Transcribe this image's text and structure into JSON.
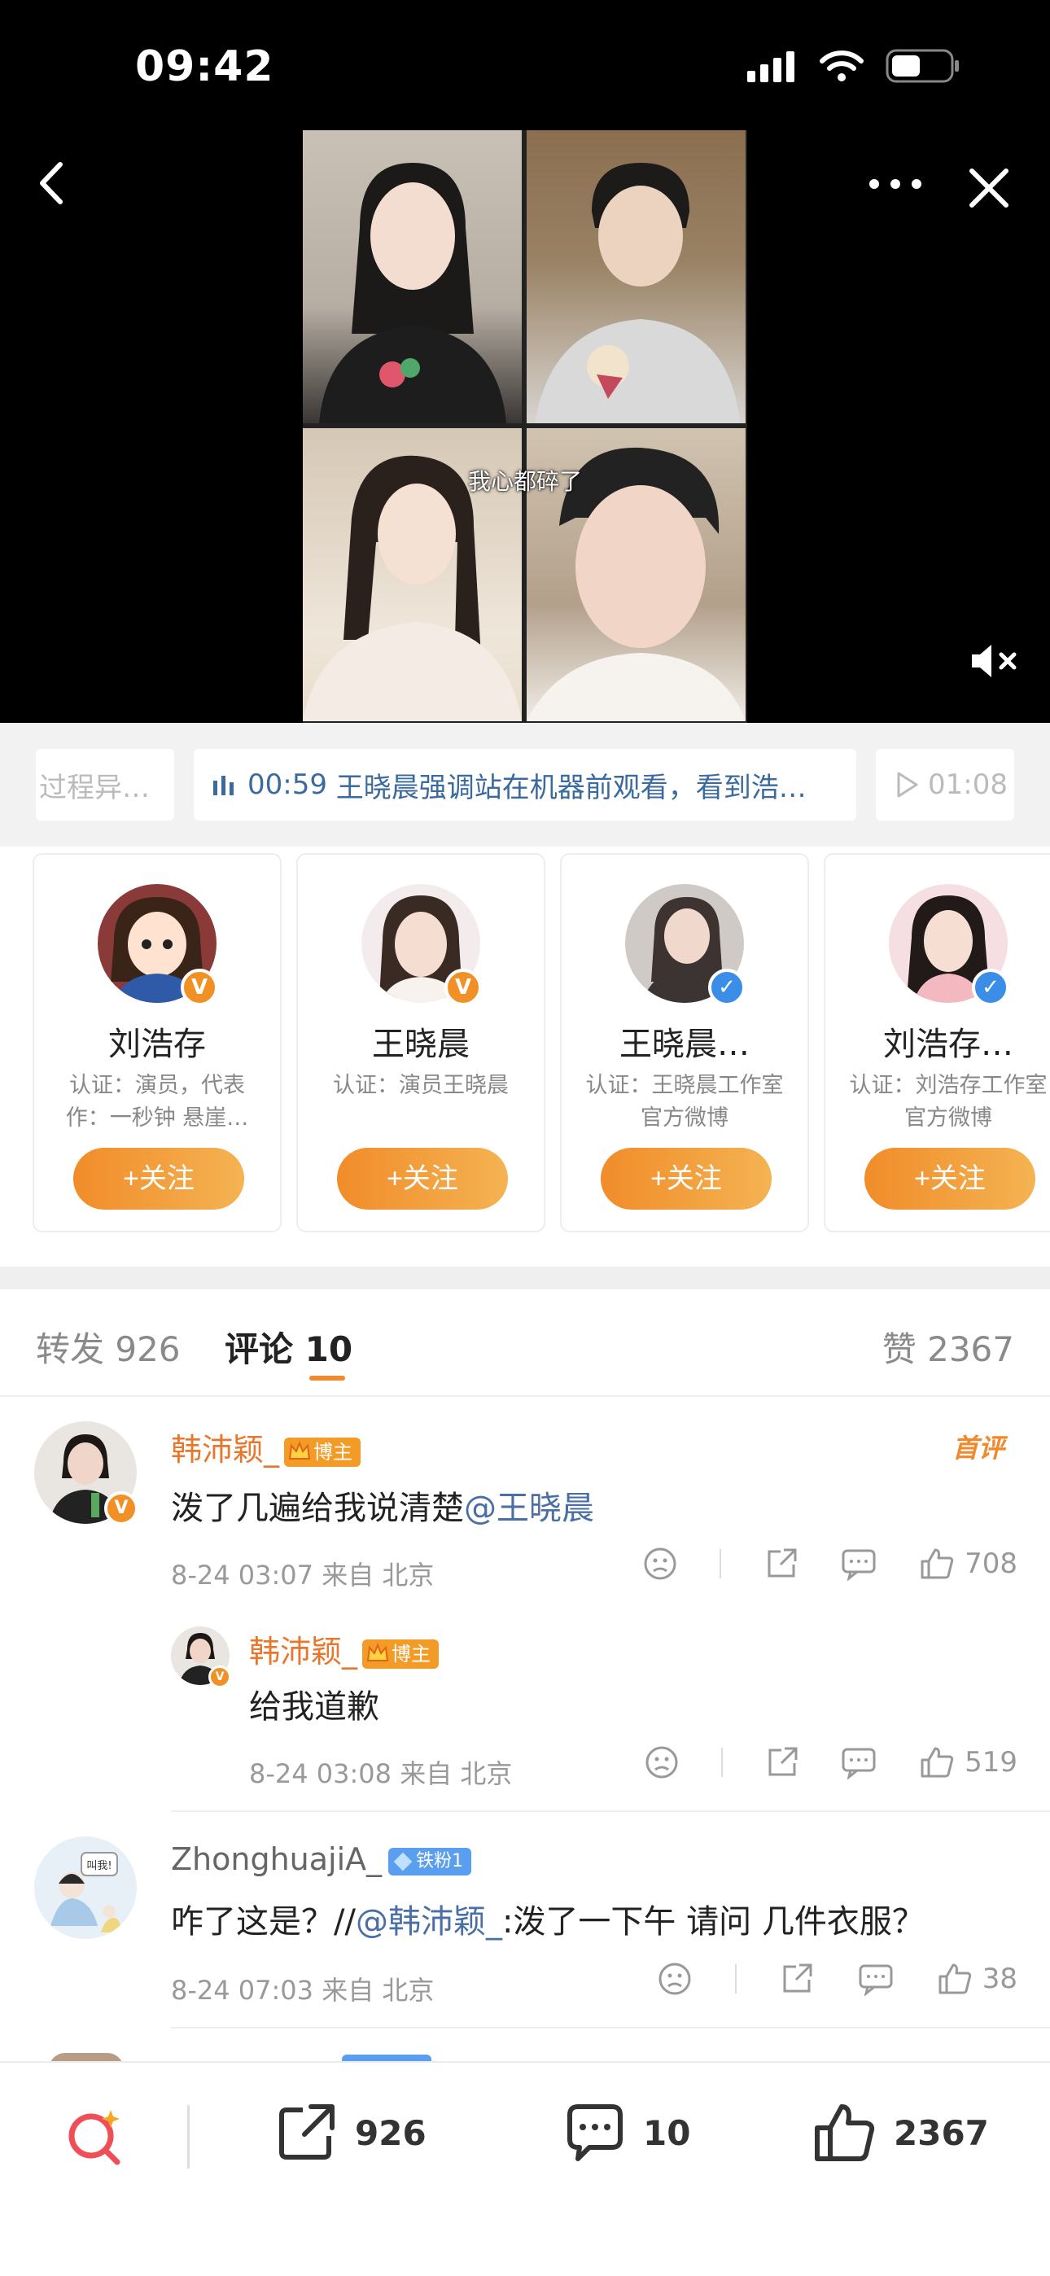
{
  "status": {
    "time": "09:42"
  },
  "video": {
    "subtitle": "我心都碎了"
  },
  "chapters": [
    {
      "text": "过程异…"
    },
    {
      "time": "00:59",
      "text": "王晓晨强调站在机器前观看，看到浩…"
    },
    {
      "time": "01:08"
    }
  ],
  "users": [
    {
      "name": "刘浩存",
      "desc": "认证：演员，代表作：一秒钟 悬崖…",
      "follow": "+关注",
      "badge": "gold"
    },
    {
      "name": "王晓晨",
      "desc": "认证：演员王晓晨",
      "follow": "+关注",
      "badge": "gold"
    },
    {
      "name": "王晓晨…",
      "desc": "认证：王晓晨工作室官方微博",
      "follow": "+关注",
      "badge": "blue"
    },
    {
      "name": "刘浩存…",
      "desc": "认证：刘浩存工作室官方微博",
      "follow": "+关注",
      "badge": "blue"
    }
  ],
  "tabs": {
    "repost": "转发 926",
    "comment": "评论 10",
    "like": "赞 2367"
  },
  "comments": [
    {
      "name": "韩沛颖_",
      "tag": "博主",
      "first": "首评",
      "text": "泼了几遍给我说清楚",
      "mention": "@王晓晨",
      "meta": "8-24 03:07  来自 北京",
      "likes": "708"
    },
    {
      "name": "韩沛颖_",
      "tag": "博主",
      "text": "给我道歉",
      "meta": "8-24 03:08  来自 北京",
      "likes": "519"
    },
    {
      "name": "ZhonghuajiA_",
      "tag": "铁粉1",
      "text_prefix": "咋了这是？//",
      "mention": "@韩沛颖_",
      "text_suffix": ":泼了一下午 请问 几件衣服？",
      "meta": "8-24 07:03  来自 北京",
      "likes": "38",
      "avatar_caption": "叫我!"
    }
  ],
  "bottom": {
    "repost": "926",
    "comment": "10",
    "like": "2367"
  },
  "colors": {
    "accent": "#f08a2c",
    "link": "#4a6fa5",
    "verified_blue": "#3b8ee8"
  }
}
